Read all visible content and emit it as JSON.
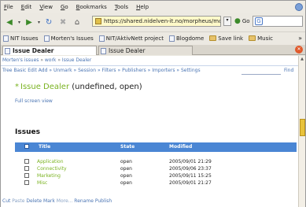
{
  "menubar": {
    "items": [
      "File",
      "Edit",
      "View",
      "Go",
      "Bookmarks",
      "Tools",
      "Help"
    ],
    "underline": [
      "F",
      "E",
      "V",
      "G",
      "B",
      "T",
      "H"
    ]
  },
  "navbar": {
    "url": "https://shared.nidelven-it.no/morpheus/mc",
    "go_label": "Go",
    "search_icon": "G"
  },
  "bookmarks": [
    {
      "label": "NIT Issues",
      "icon": "page-icon"
    },
    {
      "label": "Morten's Issues",
      "icon": "page-icon"
    },
    {
      "label": "NIT/AktivNett project",
      "icon": "page-icon"
    },
    {
      "label": "Blogdome",
      "icon": "page-icon"
    },
    {
      "label": "Save link",
      "icon": "folder-icon"
    },
    {
      "label": "Music",
      "icon": "folder-icon"
    }
  ],
  "bookmarks_more": "»",
  "tabs": [
    {
      "label": "Issue Dealer",
      "active": true
    },
    {
      "label": "Issue Dealer",
      "active": false
    }
  ],
  "page": {
    "breadcrumb": [
      "Morten's issues",
      "work",
      "Issue Dealer"
    ],
    "actions": [
      "Tree",
      "Basic",
      "Edit",
      "Add",
      "Unmark",
      "Session",
      "Filters",
      "Publishers",
      "Importers",
      "Settings"
    ],
    "find_label": "Find",
    "title_name": "Issue Dealer",
    "title_rest": " (undefined, open)",
    "fullscreen_label": "Full screen view",
    "issues_heading": "Issues",
    "table": {
      "headers": {
        "title": "Title",
        "state": "State",
        "modified": "Modified"
      },
      "rows": [
        {
          "title": "Application",
          "state": "open",
          "modified": "2005/09/01 21:29"
        },
        {
          "title": "Connectivity",
          "state": "open",
          "modified": "2005/09/06 23:37"
        },
        {
          "title": "Marketing",
          "state": "open",
          "modified": "2005/09/11 15:25"
        },
        {
          "title": "Misc",
          "state": "open",
          "modified": "2005/09/01 21:27"
        }
      ]
    },
    "footer_actions": [
      "Cut",
      "Paste",
      "Delete",
      "Mark",
      "More...",
      "Rename",
      "Publish"
    ]
  }
}
